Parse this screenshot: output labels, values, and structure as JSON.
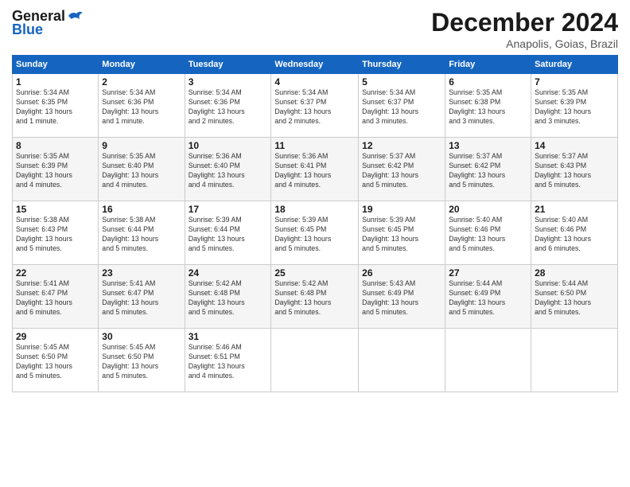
{
  "header": {
    "logo_line1": "General",
    "logo_line2": "Blue",
    "month": "December 2024",
    "location": "Anapolis, Goias, Brazil"
  },
  "days_of_week": [
    "Sunday",
    "Monday",
    "Tuesday",
    "Wednesday",
    "Thursday",
    "Friday",
    "Saturday"
  ],
  "weeks": [
    [
      {
        "num": "1",
        "info": "Sunrise: 5:34 AM\nSunset: 6:35 PM\nDaylight: 13 hours\nand 1 minute."
      },
      {
        "num": "2",
        "info": "Sunrise: 5:34 AM\nSunset: 6:36 PM\nDaylight: 13 hours\nand 1 minute."
      },
      {
        "num": "3",
        "info": "Sunrise: 5:34 AM\nSunset: 6:36 PM\nDaylight: 13 hours\nand 2 minutes."
      },
      {
        "num": "4",
        "info": "Sunrise: 5:34 AM\nSunset: 6:37 PM\nDaylight: 13 hours\nand 2 minutes."
      },
      {
        "num": "5",
        "info": "Sunrise: 5:34 AM\nSunset: 6:37 PM\nDaylight: 13 hours\nand 3 minutes."
      },
      {
        "num": "6",
        "info": "Sunrise: 5:35 AM\nSunset: 6:38 PM\nDaylight: 13 hours\nand 3 minutes."
      },
      {
        "num": "7",
        "info": "Sunrise: 5:35 AM\nSunset: 6:39 PM\nDaylight: 13 hours\nand 3 minutes."
      }
    ],
    [
      {
        "num": "8",
        "info": "Sunrise: 5:35 AM\nSunset: 6:39 PM\nDaylight: 13 hours\nand 4 minutes."
      },
      {
        "num": "9",
        "info": "Sunrise: 5:35 AM\nSunset: 6:40 PM\nDaylight: 13 hours\nand 4 minutes."
      },
      {
        "num": "10",
        "info": "Sunrise: 5:36 AM\nSunset: 6:40 PM\nDaylight: 13 hours\nand 4 minutes."
      },
      {
        "num": "11",
        "info": "Sunrise: 5:36 AM\nSunset: 6:41 PM\nDaylight: 13 hours\nand 4 minutes."
      },
      {
        "num": "12",
        "info": "Sunrise: 5:37 AM\nSunset: 6:42 PM\nDaylight: 13 hours\nand 5 minutes."
      },
      {
        "num": "13",
        "info": "Sunrise: 5:37 AM\nSunset: 6:42 PM\nDaylight: 13 hours\nand 5 minutes."
      },
      {
        "num": "14",
        "info": "Sunrise: 5:37 AM\nSunset: 6:43 PM\nDaylight: 13 hours\nand 5 minutes."
      }
    ],
    [
      {
        "num": "15",
        "info": "Sunrise: 5:38 AM\nSunset: 6:43 PM\nDaylight: 13 hours\nand 5 minutes."
      },
      {
        "num": "16",
        "info": "Sunrise: 5:38 AM\nSunset: 6:44 PM\nDaylight: 13 hours\nand 5 minutes."
      },
      {
        "num": "17",
        "info": "Sunrise: 5:39 AM\nSunset: 6:44 PM\nDaylight: 13 hours\nand 5 minutes."
      },
      {
        "num": "18",
        "info": "Sunrise: 5:39 AM\nSunset: 6:45 PM\nDaylight: 13 hours\nand 5 minutes."
      },
      {
        "num": "19",
        "info": "Sunrise: 5:39 AM\nSunset: 6:45 PM\nDaylight: 13 hours\nand 5 minutes."
      },
      {
        "num": "20",
        "info": "Sunrise: 5:40 AM\nSunset: 6:46 PM\nDaylight: 13 hours\nand 5 minutes."
      },
      {
        "num": "21",
        "info": "Sunrise: 5:40 AM\nSunset: 6:46 PM\nDaylight: 13 hours\nand 6 minutes."
      }
    ],
    [
      {
        "num": "22",
        "info": "Sunrise: 5:41 AM\nSunset: 6:47 PM\nDaylight: 13 hours\nand 6 minutes."
      },
      {
        "num": "23",
        "info": "Sunrise: 5:41 AM\nSunset: 6:47 PM\nDaylight: 13 hours\nand 5 minutes."
      },
      {
        "num": "24",
        "info": "Sunrise: 5:42 AM\nSunset: 6:48 PM\nDaylight: 13 hours\nand 5 minutes."
      },
      {
        "num": "25",
        "info": "Sunrise: 5:42 AM\nSunset: 6:48 PM\nDaylight: 13 hours\nand 5 minutes."
      },
      {
        "num": "26",
        "info": "Sunrise: 5:43 AM\nSunset: 6:49 PM\nDaylight: 13 hours\nand 5 minutes."
      },
      {
        "num": "27",
        "info": "Sunrise: 5:44 AM\nSunset: 6:49 PM\nDaylight: 13 hours\nand 5 minutes."
      },
      {
        "num": "28",
        "info": "Sunrise: 5:44 AM\nSunset: 6:50 PM\nDaylight: 13 hours\nand 5 minutes."
      }
    ],
    [
      {
        "num": "29",
        "info": "Sunrise: 5:45 AM\nSunset: 6:50 PM\nDaylight: 13 hours\nand 5 minutes."
      },
      {
        "num": "30",
        "info": "Sunrise: 5:45 AM\nSunset: 6:50 PM\nDaylight: 13 hours\nand 5 minutes."
      },
      {
        "num": "31",
        "info": "Sunrise: 5:46 AM\nSunset: 6:51 PM\nDaylight: 13 hours\nand 4 minutes."
      },
      {
        "num": "",
        "info": ""
      },
      {
        "num": "",
        "info": ""
      },
      {
        "num": "",
        "info": ""
      },
      {
        "num": "",
        "info": ""
      }
    ]
  ]
}
